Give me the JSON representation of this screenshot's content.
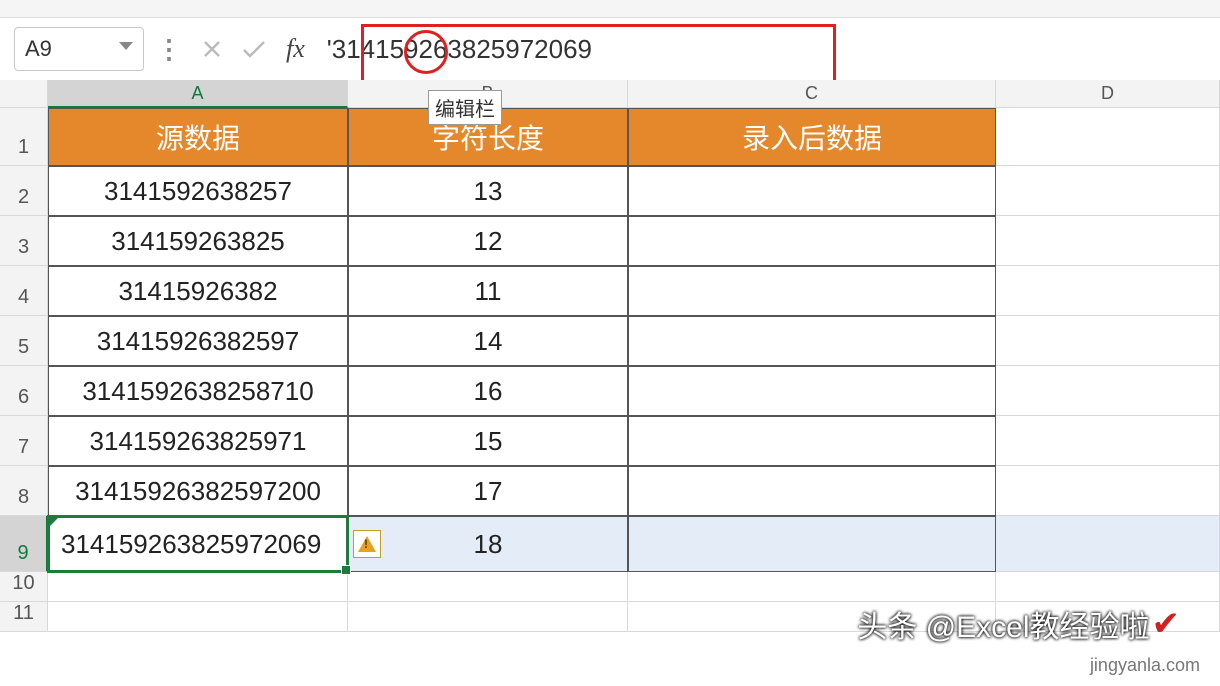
{
  "nameBox": "A9",
  "formula": "'314159263825972069",
  "tooltip": "编辑栏",
  "columns": [
    "",
    "A",
    "B",
    "C",
    "D"
  ],
  "headers": {
    "a": "源数据",
    "b": "字符长度",
    "c": "录入后数据"
  },
  "rows": [
    {
      "n": "1"
    },
    {
      "n": "2",
      "a": "3141592638257",
      "b": "13"
    },
    {
      "n": "3",
      "a": "314159263825",
      "b": "12"
    },
    {
      "n": "4",
      "a": "31415926382",
      "b": "11"
    },
    {
      "n": "5",
      "a": "31415926382597",
      "b": "14"
    },
    {
      "n": "6",
      "a": "3141592638258710",
      "b": "16"
    },
    {
      "n": "7",
      "a": "314159263825971",
      "b": "15"
    },
    {
      "n": "8",
      "a": "31415926382597200",
      "b": "17"
    },
    {
      "n": "9",
      "a": "314159263825972069",
      "b": "18"
    },
    {
      "n": "10"
    },
    {
      "n": "11"
    }
  ],
  "watermark1": "头条 @Excel",
  "watermark1b": "教经验啦",
  "watermark2": "jingyanla.com"
}
